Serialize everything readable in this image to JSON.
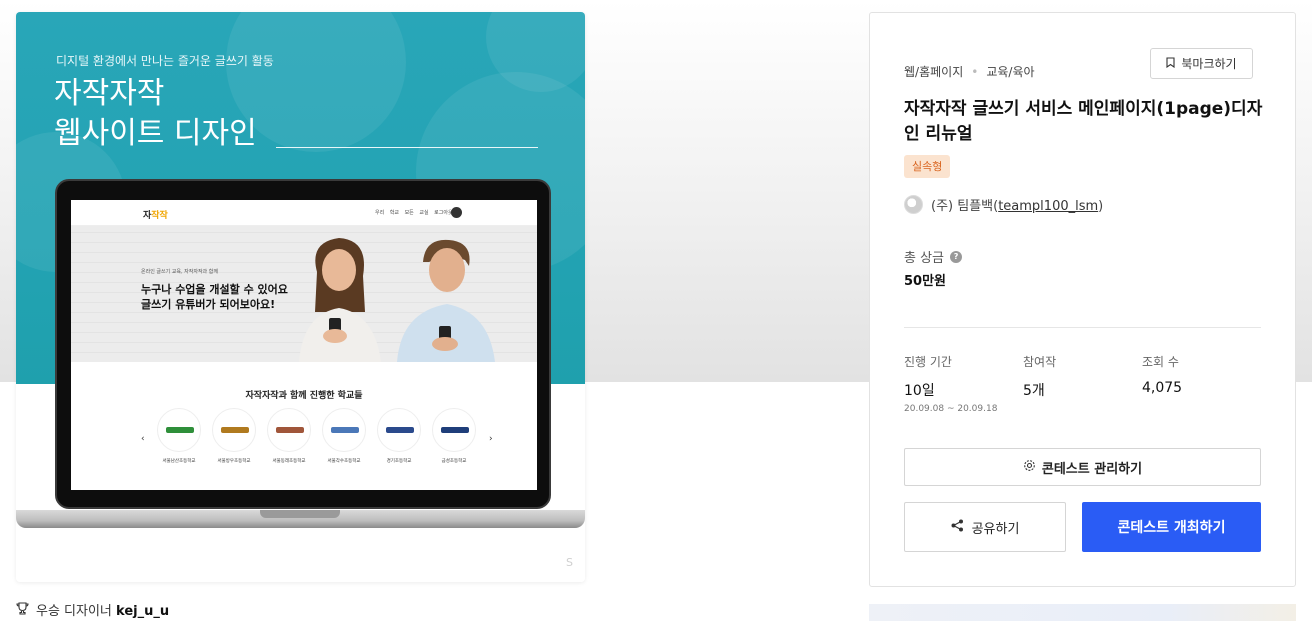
{
  "hero": {
    "subtitle": "디지털 환경에서 만나는 즐거운 글쓰기 활동",
    "title_line1": "자작자작",
    "title_line2": "웹사이트 디자인",
    "screen": {
      "logo_prefix": "자",
      "logo_highlight": "작작",
      "menu": "우리 학교  모든 교실  로그아웃",
      "small_text": "온라인 글쓰기 교육, 자작자작과 함께",
      "headline_1": "누구나 수업을 개설할 수 있어요",
      "headline_2": "글쓰기 유튜버가 되어보아요!",
      "section_title": "자작자작과 함께 진행한 학교들",
      "schools": [
        "서울남산초등학교",
        "서울방우초등학교",
        "서울동래초등학교",
        "서울각수초등학교",
        "경기초등학교",
        "금성초등학교"
      ],
      "school_colors": [
        "#2f8f3a",
        "#b07a1f",
        "#a0563a",
        "#4b78b8",
        "#2a4a8c",
        "#1f3e7a"
      ],
      "prev": "‹",
      "next": "›"
    },
    "watermark": "S"
  },
  "winner": {
    "label": "우승 디자이너",
    "name": "kej_u_u"
  },
  "panel": {
    "category": "웹/홈페이지",
    "subcategory": "교육/육아",
    "bookmark_label": "북마크하기",
    "title": "자작자작 글쓰기 서비스 메인페이지(1page)디자인 리뉴얼",
    "badge": "실속형",
    "host_company": "(주) 팀플백",
    "host_id": "teampl100_lsm",
    "prize_label": "총 상금",
    "prize_value": "50만원",
    "stats": {
      "period_label": "진행 기간",
      "period_value": "10일",
      "period_dates": "20.09.08 ~ 20.09.18",
      "entries_label": "참여작",
      "entries_value": "5개",
      "views_label": "조회 수",
      "views_value": "4,075"
    },
    "manage_label": "콘테스트 관리하기",
    "share_label": "공유하기",
    "host_label": "콘테스트 개최하기"
  },
  "colors": {
    "accent": "#2a5cf5",
    "teal": "#23a3b3",
    "badge_bg": "#fbe3cf",
    "badge_text": "#d9641f"
  }
}
